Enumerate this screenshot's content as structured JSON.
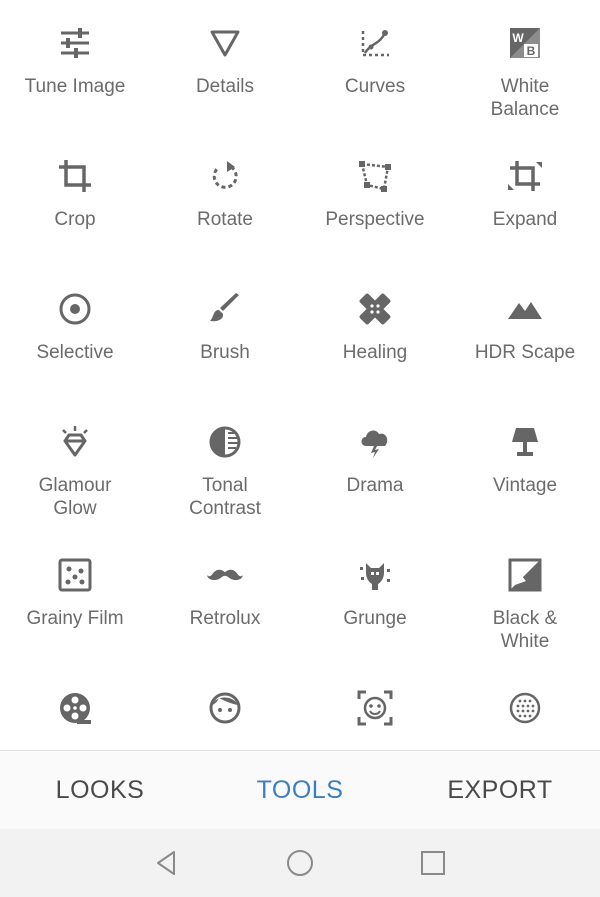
{
  "colors": {
    "icon": "#666666",
    "label": "#6b6b6b",
    "accent": "#3a7fc3",
    "tab": "#4a4a4a"
  },
  "tools": [
    {
      "label": "Tune Image",
      "icon": "tune-icon"
    },
    {
      "label": "Details",
      "icon": "details-triangle-icon"
    },
    {
      "label": "Curves",
      "icon": "curves-icon"
    },
    {
      "label": "White\nBalance",
      "icon": "white-balance-icon"
    },
    {
      "label": "Crop",
      "icon": "crop-icon"
    },
    {
      "label": "Rotate",
      "icon": "rotate-icon"
    },
    {
      "label": "Perspective",
      "icon": "perspective-icon"
    },
    {
      "label": "Expand",
      "icon": "expand-icon"
    },
    {
      "label": "Selective",
      "icon": "selective-icon"
    },
    {
      "label": "Brush",
      "icon": "brush-icon"
    },
    {
      "label": "Healing",
      "icon": "healing-icon"
    },
    {
      "label": "HDR Scape",
      "icon": "hdr-mountain-icon"
    },
    {
      "label": "Glamour\nGlow",
      "icon": "glamour-glow-icon"
    },
    {
      "label": "Tonal\nContrast",
      "icon": "tonal-contrast-icon"
    },
    {
      "label": "Drama",
      "icon": "drama-cloud-icon"
    },
    {
      "label": "Vintage",
      "icon": "vintage-lamp-icon"
    },
    {
      "label": "Grainy Film",
      "icon": "grainy-film-icon"
    },
    {
      "label": "Retrolux",
      "icon": "retrolux-mustache-icon"
    },
    {
      "label": "Grunge",
      "icon": "grunge-icon"
    },
    {
      "label": "Black &\nWhite",
      "icon": "black-white-icon"
    },
    {
      "label": "",
      "icon": "film-reel-icon"
    },
    {
      "label": "",
      "icon": "face-icon"
    },
    {
      "label": "",
      "icon": "face-detect-icon"
    },
    {
      "label": "",
      "icon": "frames-icon"
    }
  ],
  "tabs": [
    {
      "label": "LOOKS",
      "active": false
    },
    {
      "label": "TOOLS",
      "active": true
    },
    {
      "label": "EXPORT",
      "active": false
    }
  ],
  "navbar": {
    "back": "back-icon",
    "home": "home-icon",
    "recents": "recents-icon"
  }
}
